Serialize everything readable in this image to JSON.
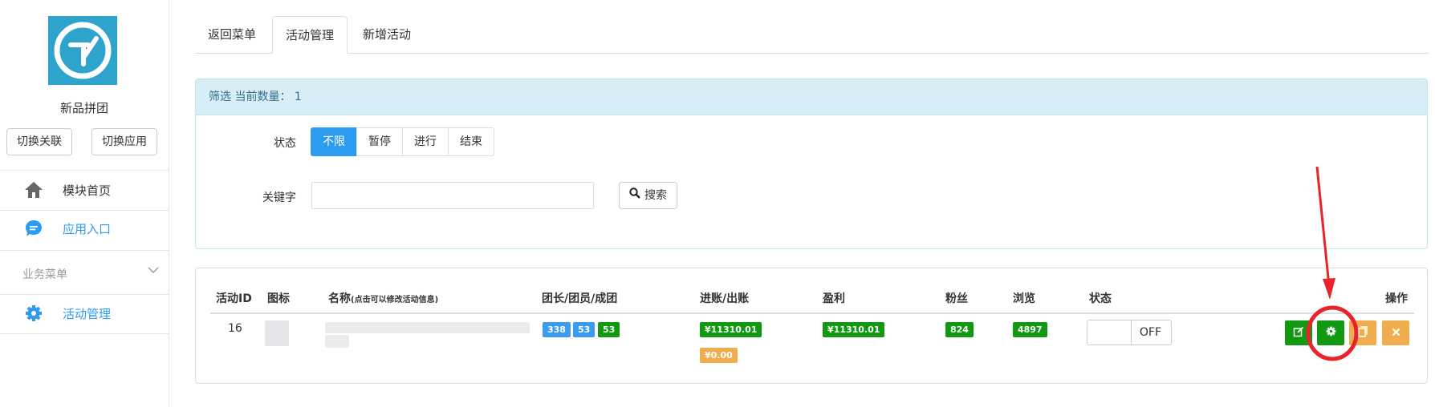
{
  "sidebar": {
    "brand_name": "新品拼团",
    "switch_link_label": "切换关联",
    "switch_app_label": "切换应用",
    "nav": [
      {
        "label": "模块首页",
        "icon": "home-icon"
      },
      {
        "label": "应用入口",
        "icon": "chat-bubble-icon"
      }
    ],
    "group_title": "业务菜单",
    "group_items": [
      {
        "label": "活动管理",
        "icon": "gear-icon"
      }
    ]
  },
  "tabs": [
    "返回菜单",
    "活动管理",
    "新增活动"
  ],
  "filter": {
    "header": "筛选 当前数量：  1",
    "status_label": "状态",
    "status_options": [
      "不限",
      "暂停",
      "进行",
      "结束"
    ],
    "keyword_label": "关键字",
    "keyword_value": "",
    "search_label": "搜索"
  },
  "table": {
    "headers": [
      "活动ID",
      "图标",
      "名称",
      "(点击可以修改活动信息)",
      "团长/团员/成团",
      "进账/出账",
      "盈利",
      "粉丝",
      "浏览",
      "状态",
      "操作"
    ],
    "row": {
      "id": "16",
      "leader": "338",
      "member": "53",
      "groups": "53",
      "income": "¥11310.01",
      "expense": "¥0.00",
      "profit": "¥11310.01",
      "fans": "824",
      "views": "4897",
      "status": "OFF"
    }
  },
  "colors": {
    "accent_blue": "#2d9bf0",
    "green": "#119a11",
    "orange": "#f0ad4e",
    "annotation_red": "#e8232a",
    "info_bg": "#d9edf7"
  }
}
